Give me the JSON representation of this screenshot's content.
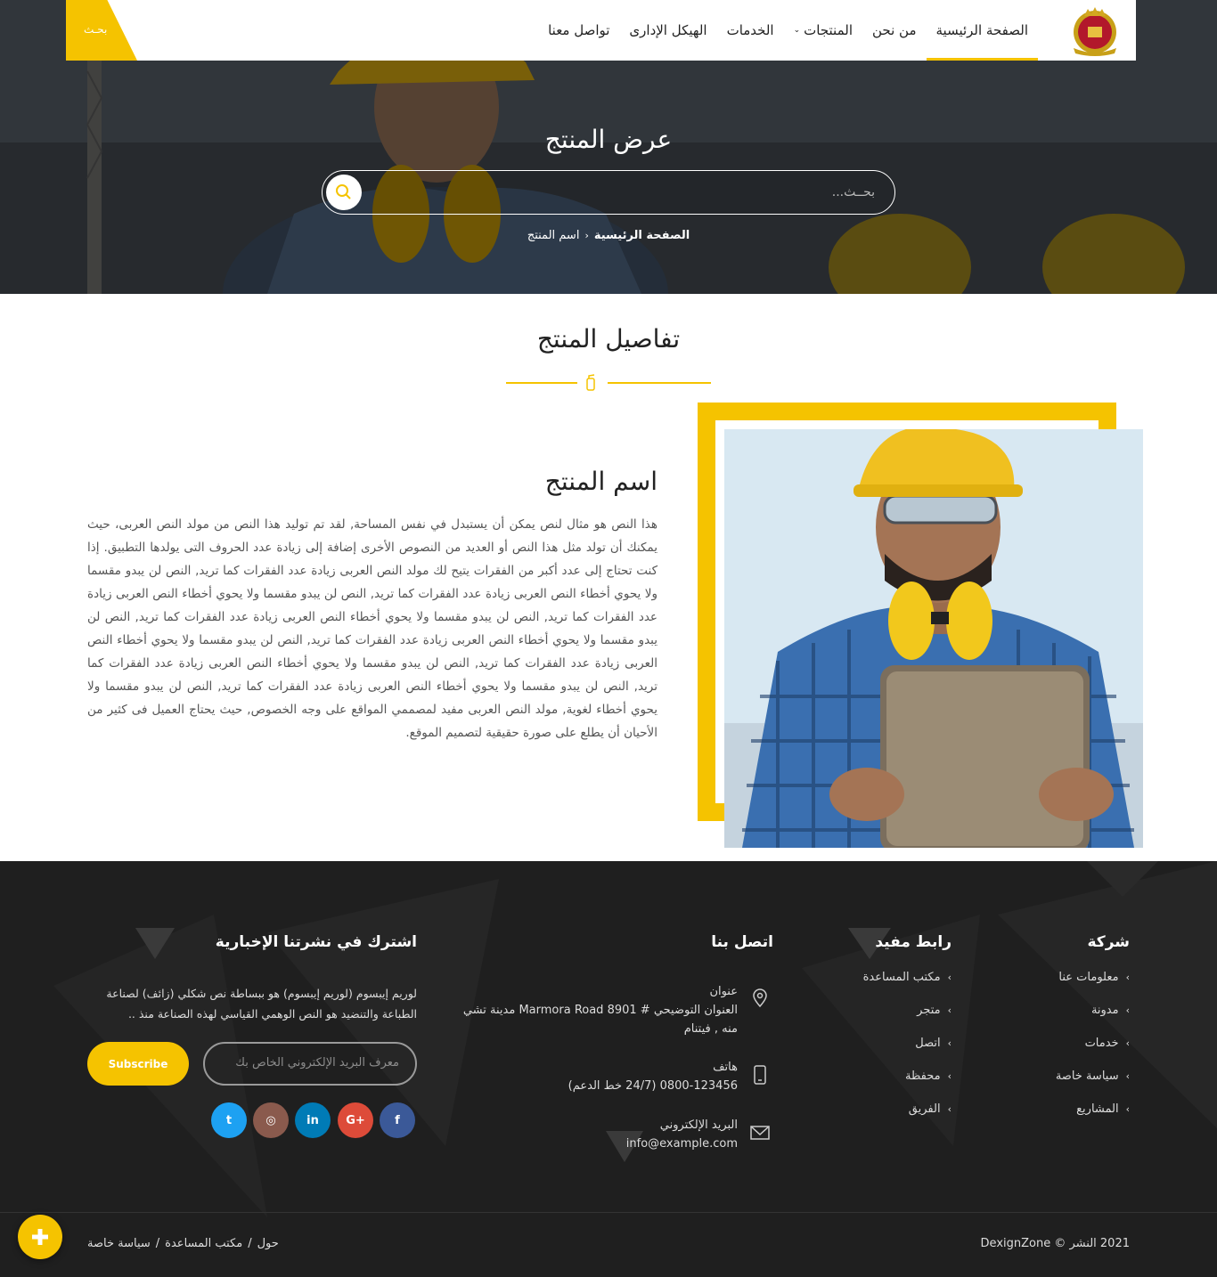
{
  "navbar": {
    "items": [
      {
        "label": "الصفحة الرئيسية",
        "active": true
      },
      {
        "label": "من نحن"
      },
      {
        "label": "المنتجات",
        "has_dropdown": true
      },
      {
        "label": "الخدمات"
      },
      {
        "label": "الهيكل الإدارى"
      },
      {
        "label": "تواصل معنا"
      }
    ],
    "search_label": "بحـث"
  },
  "hero": {
    "title": "عرض المنتج",
    "search_placeholder": "بحــث...",
    "breadcrumb": {
      "home": "الصفحة الرئيسية",
      "current": "اسم المنتج"
    }
  },
  "details": {
    "section_title": "تفاصيل المنتج",
    "product_name": "اسم المنتج",
    "description": "هذا النص هو مثال لنص يمكن أن يستبدل في نفس المساحة, لقد تم توليد هذا النص من مولد النص العربى، حيث يمكنك أن تولد مثل هذا النص أو العديد من النصوص الأخرى إضافة إلى زيادة عدد الحروف التى يولدها التطبيق. إذا كنت تحتاج إلى عدد أكبر من الفقرات يتيح لك مولد النص العربى زيادة عدد الفقرات كما تريد, النص لن يبدو مقسما ولا يحوي أخطاء النص العربى زيادة عدد الفقرات كما تريد, النص لن يبدو مقسما ولا يحوي أخطاء النص العربى زيادة عدد الفقرات كما تريد, النص لن يبدو مقسما ولا يحوي أخطاء النص العربى زيادة عدد الفقرات كما تريد, النص لن يبدو مقسما ولا يحوي أخطاء النص العربى زيادة عدد الفقرات كما تريد, النص لن يبدو مقسما ولا يحوي أخطاء النص العربى زيادة عدد الفقرات كما تريد, النص لن يبدو مقسما ولا يحوي أخطاء النص العربى زيادة عدد الفقرات كما تريد, النص لن يبدو مقسما ولا يحوي أخطاء النص العربى زيادة عدد الفقرات كما تريد, النص لن يبدو مقسما ولا يحوي أخطاء لغوية, مولد النص العربى مفيد لمصممي المواقع على وجه الخصوص, حيث يحتاج العميل فى كثير من الأحيان أن يطلع على صورة حقيقية لتصميم الموقع."
  },
  "footer": {
    "company": {
      "title": "شركة",
      "links": [
        "معلومات عنا",
        "مدونة",
        "خدمات",
        "سياسة خاصة",
        "المشاريع"
      ]
    },
    "useful": {
      "title": "رابط مفيد",
      "links": [
        "مكتب المساعدة",
        "متجر",
        "اتصل",
        "محفظة",
        "الفريق"
      ]
    },
    "contact": {
      "title": "اتصل بنا",
      "address_label": "عنوان",
      "address": "العنوان التوضيحي # Marmora Road 8901 مدينة تشي منه , فيتنام",
      "phone_label": "هاتف",
      "phone": "0800-123456 (24/7 خط الدعم)",
      "email_label": "البريد الإلكتروني",
      "email": "info@example.com"
    },
    "newsletter": {
      "title": "اشترك في نشرتنا الإخبارية",
      "text": "لوريم إيبسوم (لوريم إيبسوم) هو ببساطة نص شكلي (زائف) لصناعة الطباعة والتنضيد هو النص الوهمي القياسي لهذه الصناعة منذ ..",
      "email_placeholder": "معرف البريد الإلكتروني الخاص بك",
      "subscribe_label": "Subscribe"
    },
    "social": [
      {
        "name": "facebook",
        "glyph": "f",
        "color": "#3b5998"
      },
      {
        "name": "google-plus",
        "glyph": "G+",
        "color": "#dd4b39"
      },
      {
        "name": "linkedin",
        "glyph": "in",
        "color": "#007bb6"
      },
      {
        "name": "instagram",
        "glyph": "◎",
        "color": "#8a5a4d"
      },
      {
        "name": "twitter",
        "glyph": "t",
        "color": "#1da1f2"
      }
    ],
    "copyright": "2021 النشر © DexignZone",
    "bottom_links": [
      "حول",
      "مكتب المساعدة",
      "سياسة خاصة"
    ],
    "bottom_separator": "/"
  },
  "colors": {
    "accent": "#f5c300",
    "footer_bg": "#1f1f1f"
  },
  "fab": {
    "icon": "plus-icon"
  }
}
